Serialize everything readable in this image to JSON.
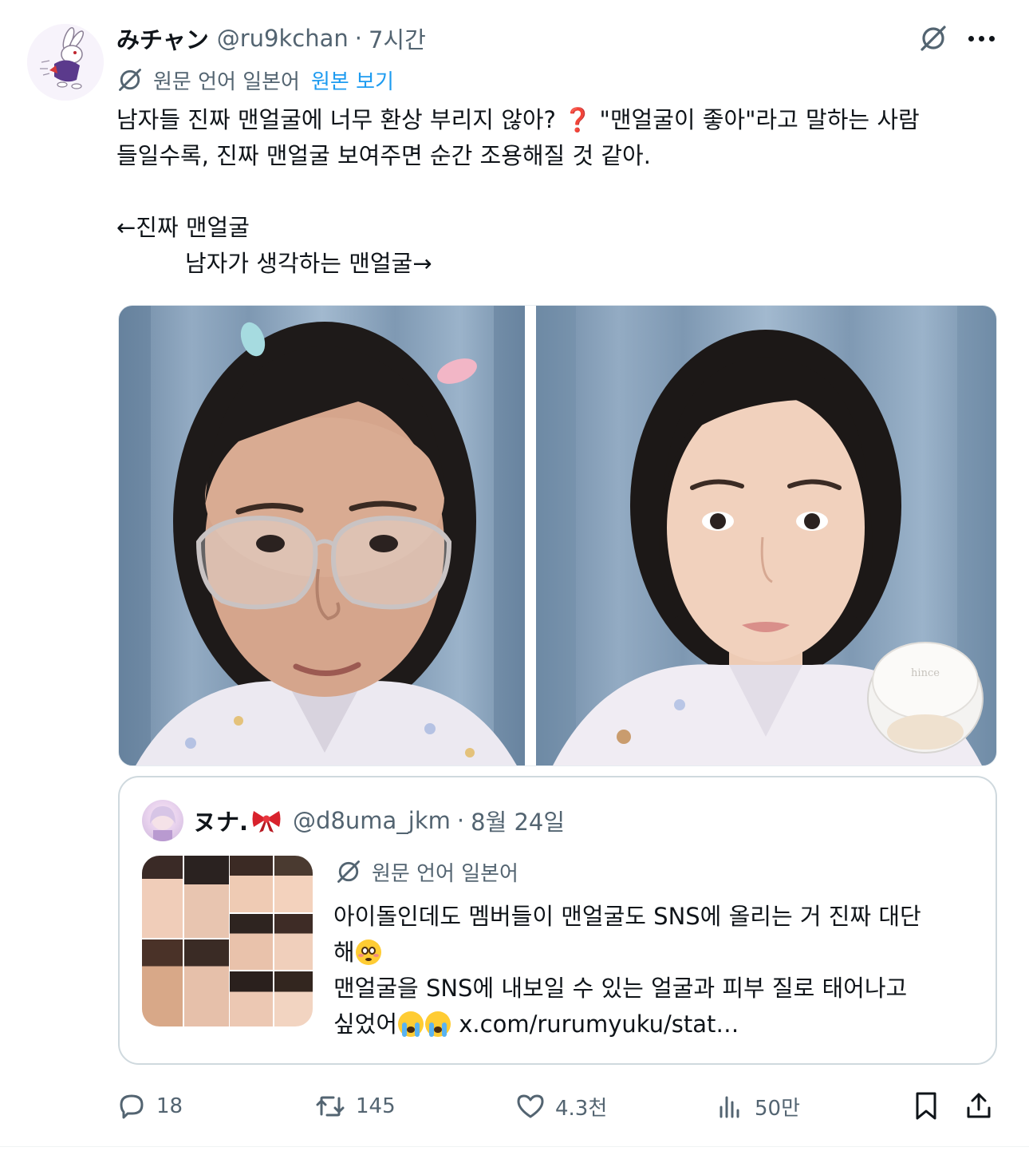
{
  "tweet": {
    "author": {
      "display_name": "みチャン",
      "handle": "@ru9kchan",
      "time": "7시간",
      "avatar_icon": "white-rabbit-avatar"
    },
    "translation": {
      "label": "원문 언어 일본어",
      "show_original": "원본 보기"
    },
    "text_lines": [
      "남자들 진짜 맨얼굴에 너무 환상 부리지 않아?",
      "\"맨얼굴이 좋아\"라고 말하는 사람",
      "들일수록, 진짜 맨얼굴 보여주면 순간 조용해질 것 같아.",
      "←진짜 맨얼굴",
      "남자가 생각하는 맨얼굴→"
    ],
    "question_emoji": "❓",
    "media": [
      {
        "name": "photo-real-bare-face"
      },
      {
        "name": "photo-imagined-bare-face",
        "product_label": "hince"
      }
    ]
  },
  "quote": {
    "display_name": "ヌナ.",
    "name_emoji_icon": "ribbon-icon",
    "handle": "@d8uma_jkm",
    "date": "8월 24일",
    "translation_label": "원문 언어 일본어",
    "text_lines": [
      "아이돌인데도 멤버들이 맨얼굴도 SNS에 올리는 거 진짜 대단",
      "해",
      "맨얼굴을 SNS에 내보일 수 있는 얼굴과 피부 질로 태어나고",
      "싶었어",
      "x.com/rurumyuku/stat…"
    ]
  },
  "actions": {
    "reply": {
      "icon": "reply-icon",
      "count": "18"
    },
    "retweet": {
      "icon": "retweet-icon",
      "count": "145"
    },
    "like": {
      "icon": "heart-icon",
      "count": "4.3천"
    },
    "views": {
      "icon": "views-icon",
      "count": "50만"
    },
    "bookmark": {
      "icon": "bookmark-icon"
    },
    "share": {
      "icon": "share-icon"
    }
  },
  "colors": {
    "text": "#0f1419",
    "secondary": "#536471",
    "link": "#1d9bf0",
    "border": "#cfd9de"
  }
}
